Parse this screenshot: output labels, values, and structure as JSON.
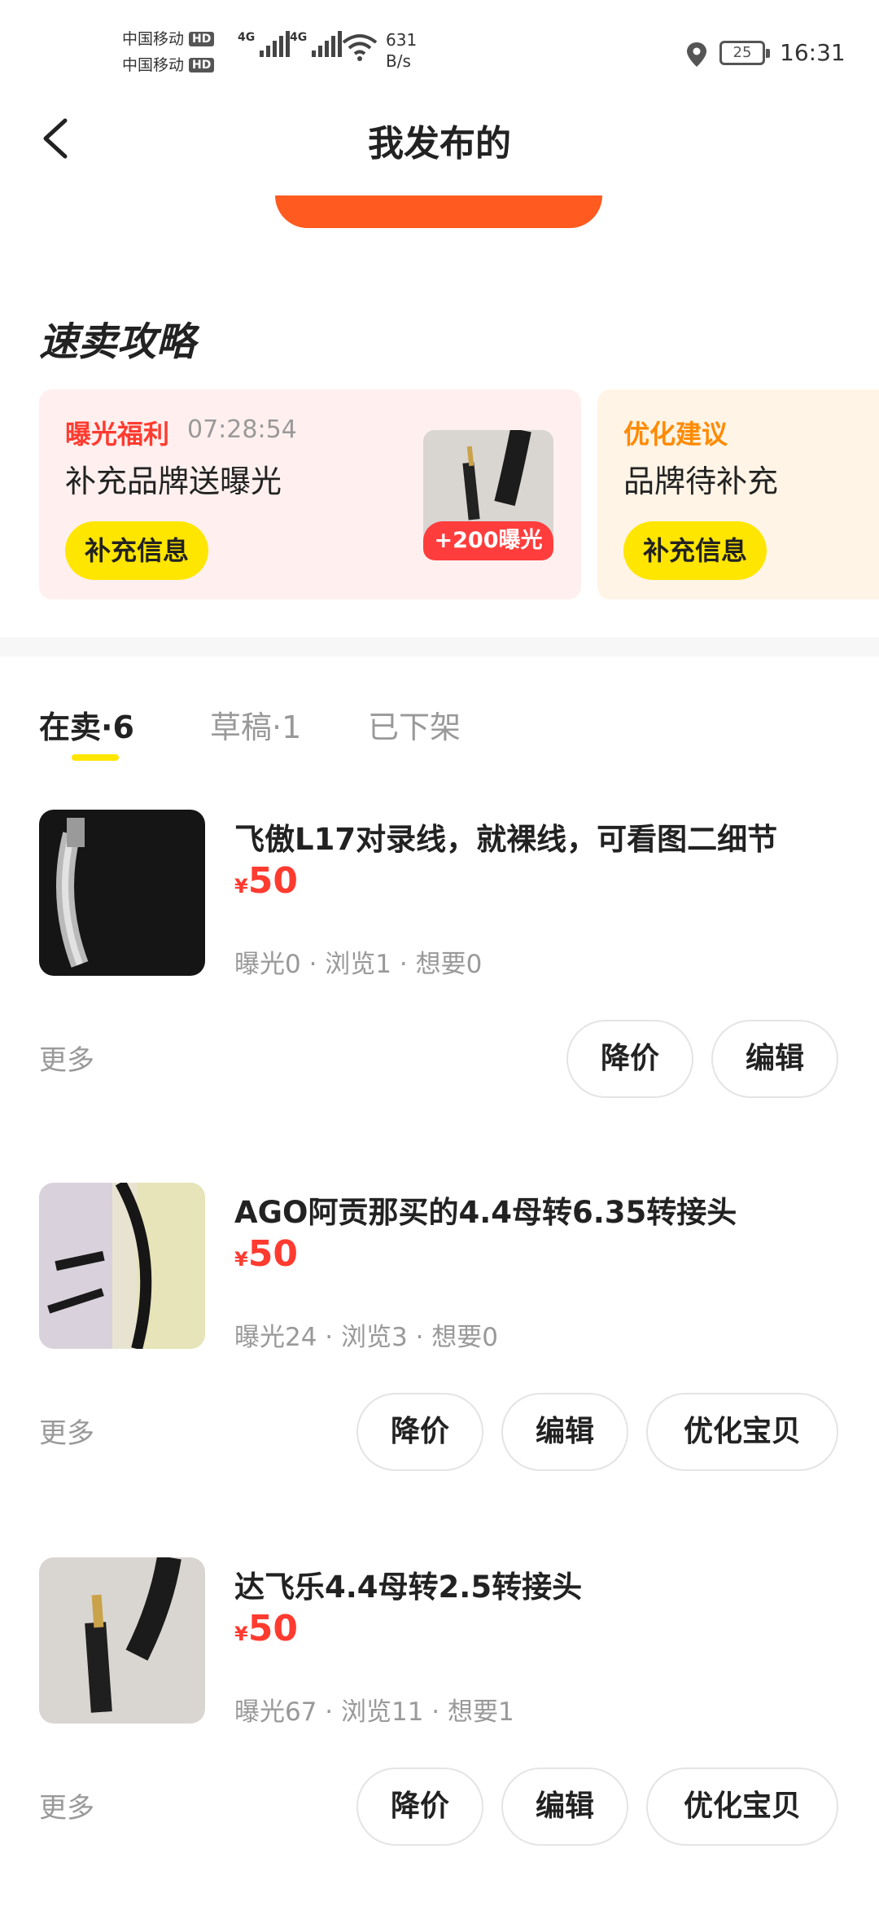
{
  "status_bar": {
    "carrier1": "中国移动",
    "carrier2": "中国移动",
    "hd": "HD",
    "net_label": "4G",
    "net_speed_value": "631",
    "net_speed_unit": "B/s",
    "battery": "25",
    "time": "16:31"
  },
  "nav": {
    "title": "我发布的"
  },
  "guide": {
    "title": "速卖攻略",
    "card1": {
      "tag": "曝光福利",
      "timer": "07:28:54",
      "headline": "补充品牌送曝光",
      "button": "补充信息",
      "badge": "+200曝光"
    },
    "card2": {
      "tag": "优化建议",
      "headline": "品牌待补充",
      "button": "补充信息"
    }
  },
  "tabs": [
    {
      "label": "在卖",
      "sep": "·",
      "count": "6"
    },
    {
      "label": "草稿",
      "sep": "·",
      "count": "1"
    },
    {
      "label": "已下架"
    }
  ],
  "items": [
    {
      "title": "飞傲L17对录线，就裸线，可看图二细节",
      "currency": "¥",
      "price": "50",
      "stats": "曝光0 · 浏览1 · 想要0",
      "more": "更多",
      "buttons": [
        "降价",
        "编辑"
      ]
    },
    {
      "title": "AGO阿贡那买的4.4母转6.35转接头",
      "currency": "¥",
      "price": "50",
      "stats": "曝光24 · 浏览3 · 想要0",
      "more": "更多",
      "buttons": [
        "降价",
        "编辑",
        "优化宝贝"
      ]
    },
    {
      "title": "达飞乐4.4母转2.5转接头",
      "currency": "¥",
      "price": "50",
      "stats": "曝光67 · 浏览11 · 想要1",
      "more": "更多",
      "buttons": [
        "降价",
        "编辑",
        "优化宝贝"
      ]
    }
  ]
}
